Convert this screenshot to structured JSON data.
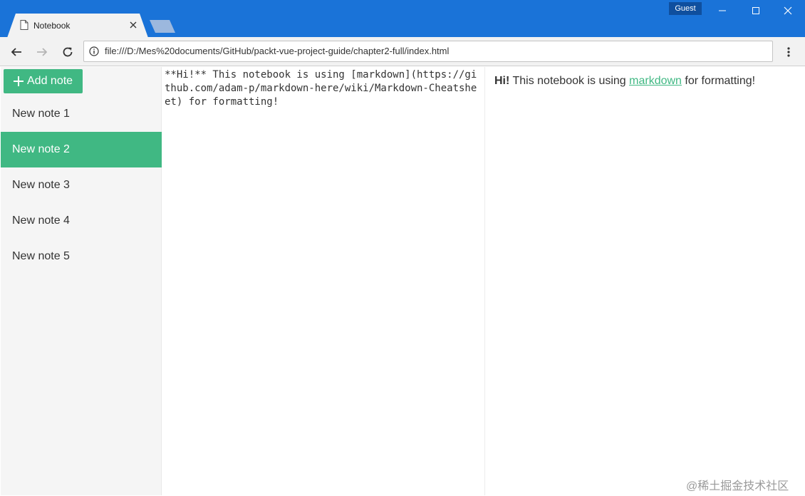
{
  "browser": {
    "tab_title": "Notebook",
    "profile_label": "Guest",
    "url": "file:///D:/Mes%20documents/GitHub/packt-vue-project-guide/chapter2-full/index.html"
  },
  "sidebar": {
    "add_note_label": "Add note",
    "notes": [
      {
        "title": "New note 1",
        "selected": false
      },
      {
        "title": "New note 2",
        "selected": true
      },
      {
        "title": "New note 3",
        "selected": false
      },
      {
        "title": "New note 4",
        "selected": false
      },
      {
        "title": "New note 5",
        "selected": false
      }
    ]
  },
  "editor": {
    "content": "**Hi!** This notebook is using [markdown](https://github.com/adam-p/markdown-here/wiki/Markdown-Cheatsheet) for formatting!"
  },
  "preview": {
    "bold": "Hi!",
    "before_link": " This notebook is using ",
    "link_text": "markdown",
    "after_link": " for formatting!"
  },
  "watermark": "@稀土掘金技术社区",
  "colors": {
    "accent": "#40b883",
    "titlebar": "#1a73d8"
  }
}
